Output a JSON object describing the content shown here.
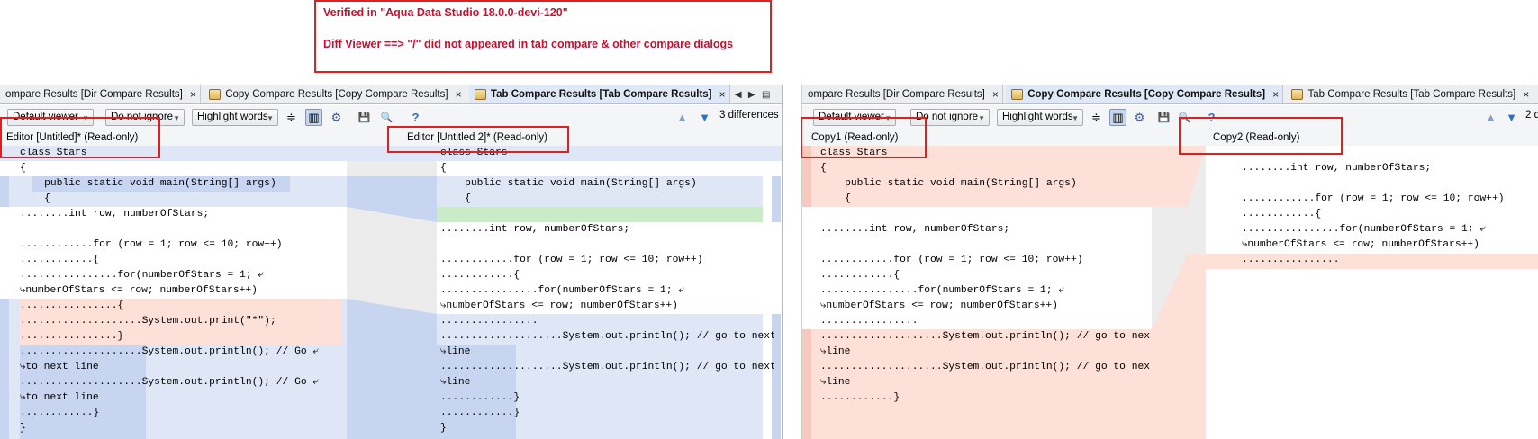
{
  "note": {
    "line1": "Verified in \"Aqua Data Studio 18.0.0-devi-120\"",
    "line2": "Diff Viewer ==> \"/\" did not appeared in tab compare & other compare dialogs"
  },
  "left_pane": {
    "tabs": [
      {
        "label": "ompare Results [Dir Compare Results]",
        "close": "×"
      },
      {
        "label": "Copy Compare Results [Copy Compare Results]",
        "close": "×"
      },
      {
        "label": "Tab Compare Results [Tab Compare Results]",
        "close": "×"
      }
    ],
    "tab_nav": {
      "prev": "◀",
      "next": "▶",
      "list": "▤"
    },
    "toolbar": {
      "viewer": "Default viewer",
      "ignore": "Do not ignore",
      "highlight": "Highlight words",
      "diff_count": "3 differences"
    },
    "editor_left_title": "Editor [Untitled]* (Read-only)",
    "editor_right_title": "Editor [Untitled 2]* (Read-only)",
    "left_code": [
      "class Stars",
      "{",
      "    public static void main(String[] args)",
      "    {",
      "........int row, numberOfStars;",
      "",
      "............for (row = 1; row <= 10; row++)",
      "............{",
      "................for(numberOfStars = 1; ⤶",
      "⤷numberOfStars <= row; numberOfStars++)",
      "................{",
      "....................System.out.print(\"*\");",
      "................}",
      "....................System.out.println(); // Go ⤶",
      "⤷to next line",
      "....................System.out.println(); // Go ⤶",
      "⤷to next line",
      "............}",
      "}"
    ],
    "right_code": [
      "class Stars",
      "{",
      "    public static void main(String[] args)",
      "    {",
      "",
      "........int row, numberOfStars;",
      "",
      "............for (row = 1; row <= 10; row++)",
      "............{",
      "................for(numberOfStars = 1; ⤶",
      "⤷numberOfStars <= row; numberOfStars++)",
      "................",
      "....................System.out.println(); // go to next ⤶",
      "⤷line",
      "....................System.out.println(); // go to next ⤶",
      "⤷line",
      "............}",
      "............}",
      "}"
    ]
  },
  "right_pane": {
    "tabs": [
      {
        "label": "ompare Results [Dir Compare Results]",
        "close": "×"
      },
      {
        "label": "Copy Compare Results [Copy Compare Results]",
        "close": "×"
      },
      {
        "label": "Tab Compare Results [Tab Compare Results]",
        "close": "×"
      }
    ],
    "toolbar": {
      "viewer": "Default viewer",
      "ignore": "Do not ignore",
      "highlight": "Highlight words",
      "diff_count": "2 d"
    },
    "editor_left_title": "Copy1 (Read-only)",
    "editor_right_title": "Copy2 (Read-only)",
    "left_code": [
      "class Stars",
      "{",
      "    public static void main(String[] args)",
      "    {",
      "",
      "........int row, numberOfStars;",
      "",
      "............for (row = 1; row <= 10; row++)",
      "............{",
      "................for(numberOfStars = 1; ⤶",
      "⤷numberOfStars <= row; numberOfStars++)",
      "................",
      "....................System.out.println(); // go to next ⤶",
      "⤷line",
      "....................System.out.println(); // go to next ⤶",
      "⤷line",
      "............}"
    ],
    "right_code": [
      "",
      "........int row, numberOfStars;",
      "",
      "............for (row = 1; row <= 10; row++)",
      "............{",
      "................for(numberOfStars = 1; ⤶",
      "⤷numberOfStars <= row; numberOfStars++)",
      "................"
    ]
  },
  "icons": {
    "up": "▲",
    "down": "▼",
    "settings": "⚙",
    "help": "?",
    "save": "💾",
    "find": "🔍",
    "collapse": "≑",
    "sidebyside": "▥"
  }
}
